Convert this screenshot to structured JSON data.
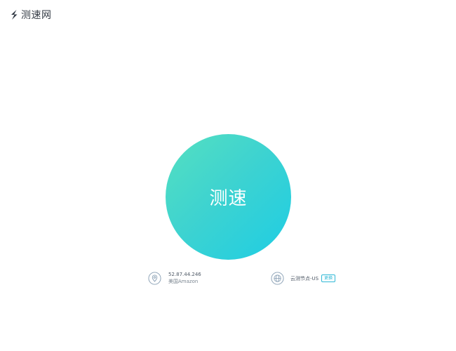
{
  "header": {
    "logo_icon": "lightning-s-icon",
    "logo_text": "测速网"
  },
  "main": {
    "start_button_label": "测速"
  },
  "ip_info": {
    "icon": "location-pin-icon",
    "ip": "52.87.44.246",
    "isp": "美国Amazon"
  },
  "node_info": {
    "icon": "globe-icon",
    "label": "云测节点-US",
    "change_label": "更换"
  },
  "colors": {
    "gradient_start": "#55e0c0",
    "gradient_end": "#1ecde4",
    "accent": "#2fb8d6",
    "icon_stroke": "#8aa0b5"
  }
}
